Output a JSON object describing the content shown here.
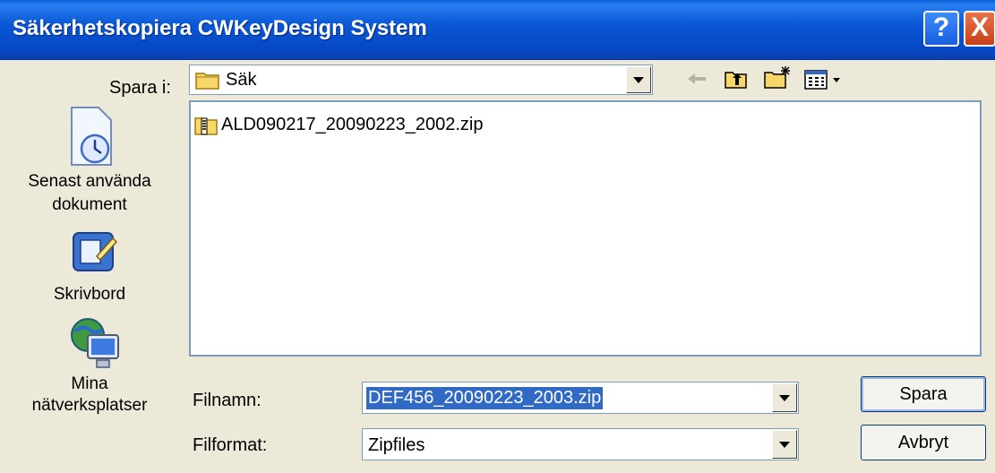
{
  "window": {
    "title": "Säkerhetskopiera CWKeyDesign System",
    "help_glyph": "?",
    "close_glyph": "X"
  },
  "save_in": {
    "label": "Spara i:",
    "value": "Säk"
  },
  "toolbar": {
    "icons": [
      "back-arrow-icon",
      "up-folder-icon",
      "new-folder-icon",
      "view-menu-icon"
    ]
  },
  "places": [
    {
      "label": "Senast använda dokument",
      "icon": "recent-documents-icon"
    },
    {
      "label": "Skrivbord",
      "icon": "desktop-icon"
    },
    {
      "label": "Mina nätverksplatser",
      "icon": "network-places-icon"
    }
  ],
  "places_text": {
    "recent_line1": "Senast använda",
    "recent_line2": "dokument",
    "desktop": "Skrivbord",
    "network_line1": "Mina",
    "network_line2": "nätverksplatser"
  },
  "files": [
    {
      "name": "ALD090217_20090223_2002.zip",
      "icon": "zip-folder-icon"
    }
  ],
  "filename": {
    "label": "Filnamn:",
    "value": "DEF456_20090223_2003.zip"
  },
  "filetype": {
    "label": "Filformat:",
    "value": "Zipfiles"
  },
  "buttons": {
    "save": "Spara",
    "cancel": "Avbryt"
  },
  "colors": {
    "titlebar": "#0a58d6",
    "dialog_bg": "#ece9d8",
    "selection": "#316ac5"
  }
}
